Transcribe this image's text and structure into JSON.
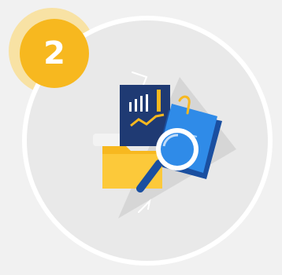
{
  "step": {
    "number": "2"
  },
  "illustration": {
    "icon": "document-analysis-magnifier-icon"
  },
  "colors": {
    "background": "#f1f1f1",
    "ring": "#ffffff",
    "ring_fill": "#e9e9e9",
    "badge": "#f7b81f",
    "badge_halo": "#f8e2a4",
    "navy": "#1f3a73",
    "blue": "#1e88e5",
    "folder_yellow": "#f7b81f",
    "backdrop_gray": "#d6d6d6"
  }
}
